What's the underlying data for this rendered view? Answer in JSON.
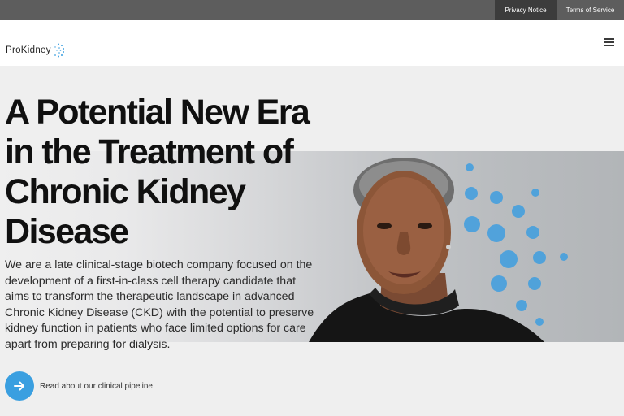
{
  "topbar": {
    "privacy_label": "Privacy Notice",
    "terms_label": "Terms of Service"
  },
  "header": {
    "logo_text": "ProKidney",
    "menu_icon": "hamburger-menu-icon"
  },
  "hero": {
    "headline_lines": [
      "A Potential New Era",
      "in the Treatment of",
      "Chronic Kidney",
      "Disease"
    ],
    "intro_lines": [
      "We are a late clinical-stage biotech company focused on the",
      "development of a first-in-class cell therapy candidate that",
      "aims to transform the therapeutic landscape in advanced",
      "Chronic Kidney Disease (CKD) with the potential to preserve",
      "kidney function in patients who face limited options for care",
      "apart from preparing for dialysis."
    ],
    "cta_label": "Read about our clinical pipeline",
    "cta_icon": "arrow-right-icon"
  },
  "colors": {
    "accent": "#3a9fe0",
    "topbar": "#5d5d5d",
    "topbar_active": "#3c3c3c",
    "headline": "#101010"
  }
}
